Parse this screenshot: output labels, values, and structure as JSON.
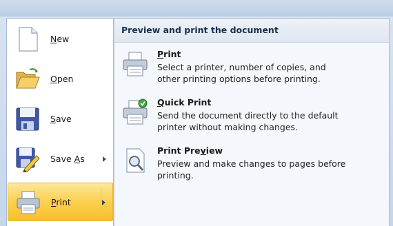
{
  "left_menu": {
    "items": [
      {
        "label_pre": "",
        "label_key": "N",
        "label_post": "ew",
        "icon": "new-document-icon",
        "has_submenu": false
      },
      {
        "label_pre": "",
        "label_key": "O",
        "label_post": "pen",
        "icon": "open-folder-icon",
        "has_submenu": false
      },
      {
        "label_pre": "",
        "label_key": "S",
        "label_post": "ave",
        "icon": "save-floppy-icon",
        "has_submenu": false
      },
      {
        "label_pre": "Save ",
        "label_key": "A",
        "label_post": "s",
        "icon": "save-as-icon",
        "has_submenu": true
      },
      {
        "label_pre": "",
        "label_key": "P",
        "label_post": "rint",
        "icon": "printer-icon",
        "has_submenu": true,
        "selected": true
      }
    ]
  },
  "submenu": {
    "header": "Preview and print the document",
    "items": [
      {
        "name_pre": "",
        "name_key": "P",
        "name_post": "rint",
        "desc_line1": "Select a printer, number of copies, and",
        "desc_line2": "other printing options before printing.",
        "icon": "printer-icon"
      },
      {
        "name_pre": "",
        "name_key": "Q",
        "name_post": "uick Print",
        "desc_line1": "Send the document directly to the default",
        "desc_line2": "printer without making changes.",
        "icon": "quick-print-icon"
      },
      {
        "name_pre": "Print Pre",
        "name_key": "v",
        "name_post": "iew",
        "desc_line1": "Preview and make changes to pages before",
        "desc_line2": "printing.",
        "icon": "print-preview-icon"
      }
    ]
  },
  "colors": {
    "selected_highlight": "#fbd04e",
    "header_text": "#15314f"
  }
}
